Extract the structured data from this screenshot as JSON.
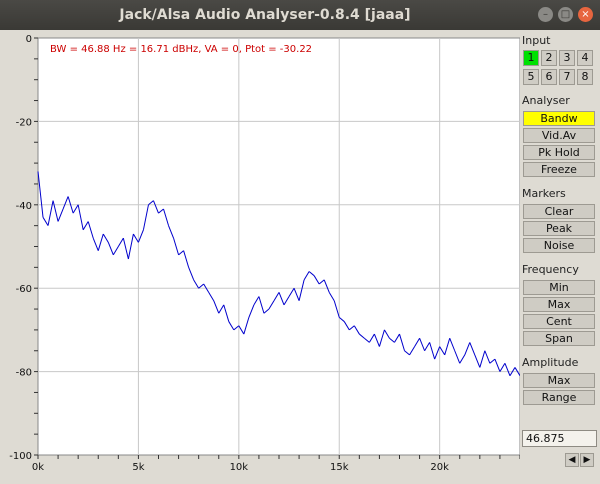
{
  "window": {
    "title": "Jack/Alsa Audio Analyser-0.8.4  [jaaa]"
  },
  "window_controls": {
    "minimize": "–",
    "maximize": "□",
    "close": "×"
  },
  "status_text": "BW = 46.88 Hz = 16.71 dBHz, VA = 0, Ptot = -30.22",
  "panel": {
    "input_label": "Input",
    "inputs": [
      "1",
      "2",
      "3",
      "4",
      "5",
      "6",
      "7",
      "8"
    ],
    "analyser_label": "Analyser",
    "analyser_buttons": [
      "Bandw",
      "Vid.Av",
      "Pk Hold",
      "Freeze"
    ],
    "markers_label": "Markers",
    "marker_buttons": [
      "Clear",
      "Peak",
      "Noise"
    ],
    "frequency_label": "Frequency",
    "frequency_buttons": [
      "Min",
      "Max",
      "Cent",
      "Span"
    ],
    "amplitude_label": "Amplitude",
    "amplitude_buttons": [
      "Max",
      "Range"
    ],
    "readout": "46.875",
    "arrow_left": "◀",
    "arrow_right": "▶"
  },
  "colors": {
    "trace": "#0000cc",
    "status_text": "#cc0000",
    "active_button": "#ffff00",
    "active_input": "#00e000"
  },
  "chart_data": {
    "type": "line",
    "x_tick_labels": [
      "0k",
      "5k",
      "10k",
      "15k",
      "20k"
    ],
    "y_tick_labels": [
      "0",
      "-20",
      "-40",
      "-60",
      "-80",
      "-100"
    ],
    "xlim": [
      0,
      24000
    ],
    "ylim": [
      -100,
      0
    ],
    "grid": true,
    "series": [
      {
        "x": [
          0,
          250,
          500,
          750,
          1000,
          1250,
          1500,
          1750,
          2000,
          2250,
          2500,
          2750,
          3000,
          3250,
          3500,
          3750,
          4000,
          4250,
          4500,
          4750,
          5000,
          5250,
          5500,
          5750,
          6000,
          6250,
          6500,
          6750,
          7000,
          7250,
          7500,
          7750,
          8000,
          8250,
          8500,
          8750,
          9000,
          9250,
          9500,
          9750,
          10000,
          10250,
          10500,
          10750,
          11000,
          11250,
          11500,
          11750,
          12000,
          12250,
          12500,
          12750,
          13000,
          13250,
          13500,
          13750,
          14000,
          14250,
          14500,
          14750,
          15000,
          15250,
          15500,
          15750,
          16000,
          16250,
          16500,
          16750,
          17000,
          17250,
          17500,
          17750,
          18000,
          18250,
          18500,
          18750,
          19000,
          19250,
          19500,
          19750,
          20000,
          20250,
          20500,
          20750,
          21000,
          21250,
          21500,
          21750,
          22000,
          22250,
          22500,
          22750,
          23000,
          23250,
          23500,
          23750,
          24000
        ],
        "values": [
          -32,
          -43,
          -45,
          -39,
          -44,
          -41,
          -38,
          -42,
          -40,
          -46,
          -44,
          -48,
          -51,
          -47,
          -49,
          -52,
          -50,
          -48,
          -53,
          -47,
          -49,
          -46,
          -40,
          -39,
          -42,
          -41,
          -45,
          -48,
          -52,
          -51,
          -55,
          -58,
          -60,
          -59,
          -61,
          -63,
          -66,
          -64,
          -68,
          -70,
          -69,
          -71,
          -67,
          -64,
          -62,
          -66,
          -65,
          -63,
          -61,
          -64,
          -62,
          -60,
          -63,
          -58,
          -56,
          -57,
          -59,
          -58,
          -61,
          -63,
          -67,
          -68,
          -70,
          -69,
          -71,
          -72,
          -73,
          -71,
          -74,
          -70,
          -72,
          -73,
          -71,
          -75,
          -76,
          -74,
          -72,
          -75,
          -73,
          -77,
          -74,
          -76,
          -72,
          -75,
          -78,
          -76,
          -73,
          -76,
          -79,
          -75,
          -78,
          -77,
          -80,
          -78,
          -81,
          -79,
          -81
        ]
      }
    ]
  }
}
